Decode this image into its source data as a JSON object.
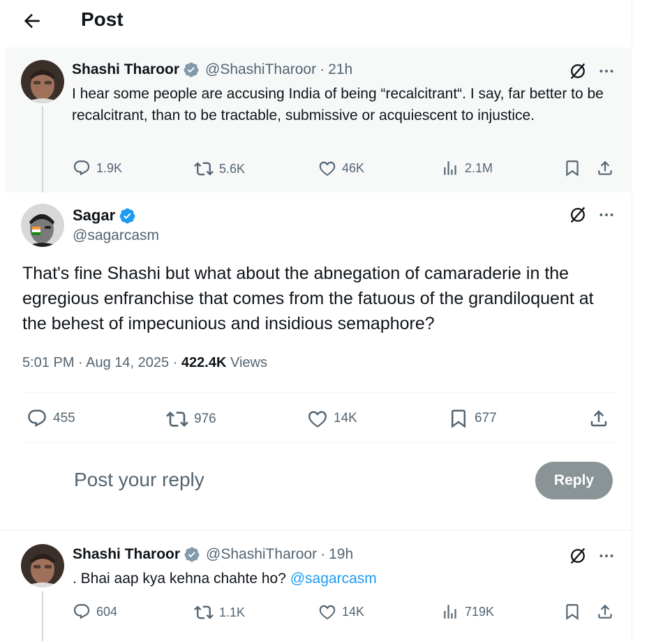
{
  "header": {
    "title": "Post"
  },
  "parent_tweet": {
    "name": "Shashi Tharoor",
    "handle": "@ShashiTharoor",
    "time": "21h",
    "text": "I hear some people are accusing India of being “recalcitrant“. I say, far better to be recalcitrant, than to be tractable, submissive or acquiescent to injustice.",
    "replies": "1.9K",
    "reposts": "5.6K",
    "likes": "46K",
    "views": "2.1M"
  },
  "main_tweet": {
    "name": "Sagar",
    "handle": "@sagarcasm",
    "text": "That's fine Shashi but what about the abnegation of camaraderie in the egregious enfranchise that comes from the fatuous of the grandiloquent at the behest of impecunious and insidious semaphore?",
    "timestamp": "5:01 PM · Aug 14, 2025 · ",
    "views_count": "422.4K",
    "views_label": " Views",
    "replies": "455",
    "reposts": "976",
    "likes": "14K",
    "bookmarks": "677"
  },
  "reply_box": {
    "placeholder": "Post your reply",
    "button_label": "Reply"
  },
  "reply_tweet": {
    "name": "Shashi Tharoor",
    "handle": "@ShashiTharoor",
    "time": "19h",
    "text": ". Bhai aap kya kehna chahte ho? ",
    "mention": "@sagarcasm",
    "replies": "604",
    "reposts": "1.1K",
    "likes": "14K",
    "views": "719K"
  },
  "colors": {
    "accent": "#1d9bf0",
    "gray_text": "#536471",
    "verified_gray": "#829aab",
    "reply_button": "#8a9396"
  },
  "icons": [
    "back-arrow-icon",
    "verified-badge-icon",
    "grok-icon",
    "more-icon",
    "reply-icon",
    "repost-icon",
    "like-icon",
    "views-icon",
    "bookmark-icon",
    "share-icon"
  ]
}
